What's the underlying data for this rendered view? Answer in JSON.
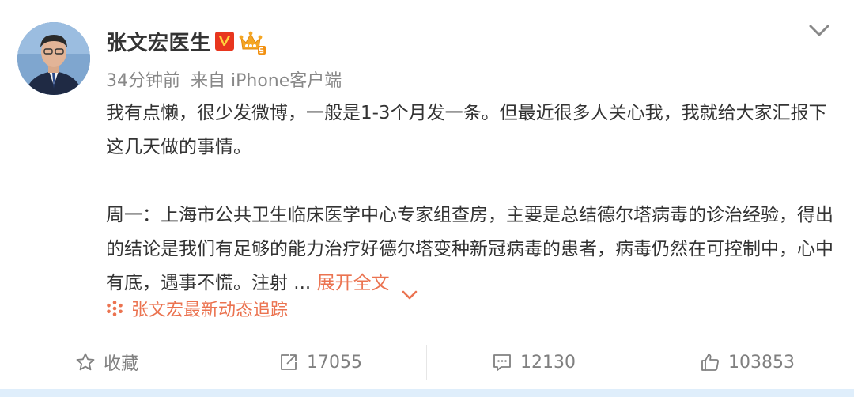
{
  "post": {
    "author_name": "张文宏医生",
    "time": "34分钟前",
    "source": "来自 iPhone客户端",
    "paragraph1": "我有点懒，很少发微博，一般是1-3个月发一条。但最近很多人关心我，我就给大家汇报下这几天做的事情。",
    "paragraph2": "周一：上海市公共卫生临床医学中心专家组查房，主要是总结德尔塔病毒的诊治经验，得出的结论是我们有足够的能力治疗好德尔塔变种新冠病毒的患者，病毒仍然在可控制中，心中有底，遇事不慌。注射 ...",
    "expand_label": "展开全文",
    "topic_label": "张文宏最新动态追踪"
  },
  "actions": {
    "favorite_label": "收藏",
    "repost_count": "17055",
    "comment_count": "12130",
    "like_count": "103853"
  },
  "colors": {
    "accent": "#eb7350",
    "text": "#333333",
    "meta": "#888888",
    "verified_badge": "#e8361e",
    "crown": "#f5a623"
  },
  "icons": [
    "verified-v-icon",
    "vip-crown-icon",
    "chevron-down-icon",
    "topic-sparkle-icon",
    "star-icon",
    "repost-icon",
    "comment-icon",
    "thumbs-up-icon"
  ]
}
